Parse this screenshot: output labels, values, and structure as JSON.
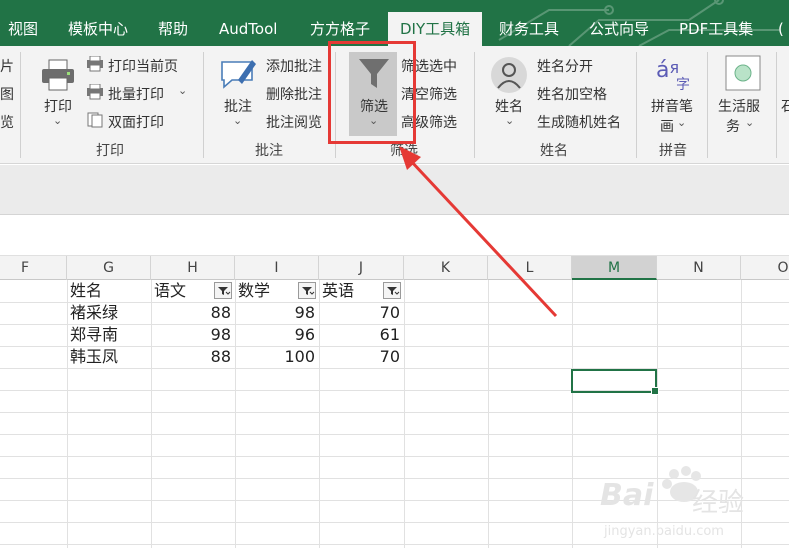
{
  "ribbon_tabs": [
    "视图",
    "模板中心",
    "帮助",
    "AudTool",
    "方方格子",
    "DIY工具箱",
    "财务工具",
    "公式向导",
    "PDF工具集",
    "("
  ],
  "left_cut": [
    "片",
    "图",
    "览"
  ],
  "print_group": {
    "big_label": "打印",
    "items": [
      "打印当前页",
      "批量打印",
      "双面打印"
    ],
    "label": "打印"
  },
  "comment_group": {
    "big_label": "批注",
    "items": [
      "添加批注",
      "删除批注",
      "批注阅览"
    ],
    "label": "批注"
  },
  "filter_group": {
    "big_label": "筛选",
    "items": [
      "筛选选中",
      "清空筛选",
      "高级筛选"
    ],
    "label": "筛选"
  },
  "name_group": {
    "big_label": "姓名",
    "items": [
      "姓名分开",
      "姓名加空格",
      "生成随机姓名"
    ],
    "label": "姓名"
  },
  "pinyin_group": {
    "big_label_1": "拼音笔",
    "big_label_2": "画",
    "label": "拼音",
    "glyph_1": "á",
    "glyph_2": "я",
    "glyph_3": "字"
  },
  "life_group": {
    "label_1": "生活服",
    "label_2": "务"
  },
  "right_cut": "石",
  "columns": [
    "F",
    "G",
    "H",
    "I",
    "J",
    "K",
    "L",
    "M",
    "N",
    "O"
  ],
  "headers": [
    "姓名",
    "语文",
    "数学",
    "英语"
  ],
  "rows": [
    {
      "name": "褚采绿",
      "chinese": "88",
      "math": "98",
      "english": "70"
    },
    {
      "name": "郑寻南",
      "chinese": "98",
      "math": "96",
      "english": "61"
    },
    {
      "name": "韩玉凤",
      "chinese": "88",
      "math": "100",
      "english": "70"
    }
  ],
  "colors": {
    "accent": "#217346",
    "highlight": "#e53935"
  },
  "watermark": {
    "line1": "Bai",
    "line2": "经验",
    "url": "jingyan.baidu.com"
  }
}
